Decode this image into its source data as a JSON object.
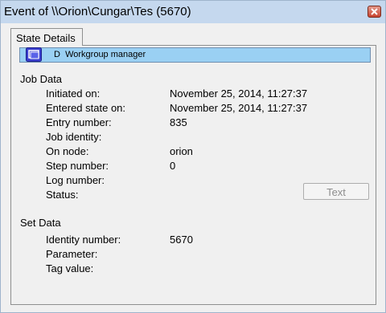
{
  "window": {
    "title": "Event of \\\\Orion\\Cungar\\Tes (5670)"
  },
  "tabs": [
    {
      "label": "State Details"
    }
  ],
  "header": {
    "letter": "D",
    "label": "Workgroup manager"
  },
  "job_data": {
    "title": "Job Data",
    "fields": [
      {
        "label": "Initiated on:",
        "value": "November 25, 2014, 11:27:37"
      },
      {
        "label": "Entered state on:",
        "value": "November 25, 2014, 11:27:37"
      },
      {
        "label": "Entry number:",
        "value": "835"
      },
      {
        "label": "Job identity:",
        "value": ""
      },
      {
        "label": "On node:",
        "value": "orion"
      },
      {
        "label": "Step number:",
        "value": "0"
      },
      {
        "label": "Log number:",
        "value": ""
      },
      {
        "label": "Status:",
        "value": ""
      }
    ]
  },
  "set_data": {
    "title": "Set Data",
    "fields": [
      {
        "label": "Identity number:",
        "value": "5670"
      },
      {
        "label": "Parameter:",
        "value": ""
      },
      {
        "label": "Tag value:",
        "value": ""
      }
    ]
  },
  "buttons": {
    "text_label": "Text",
    "text_enabled": false
  },
  "icons": {
    "close": "close-icon",
    "header": "window-icon"
  },
  "colors": {
    "header_bar": "#9ad0f3",
    "titlebar": "#c5d8ee",
    "close_button": "#c8432f"
  }
}
